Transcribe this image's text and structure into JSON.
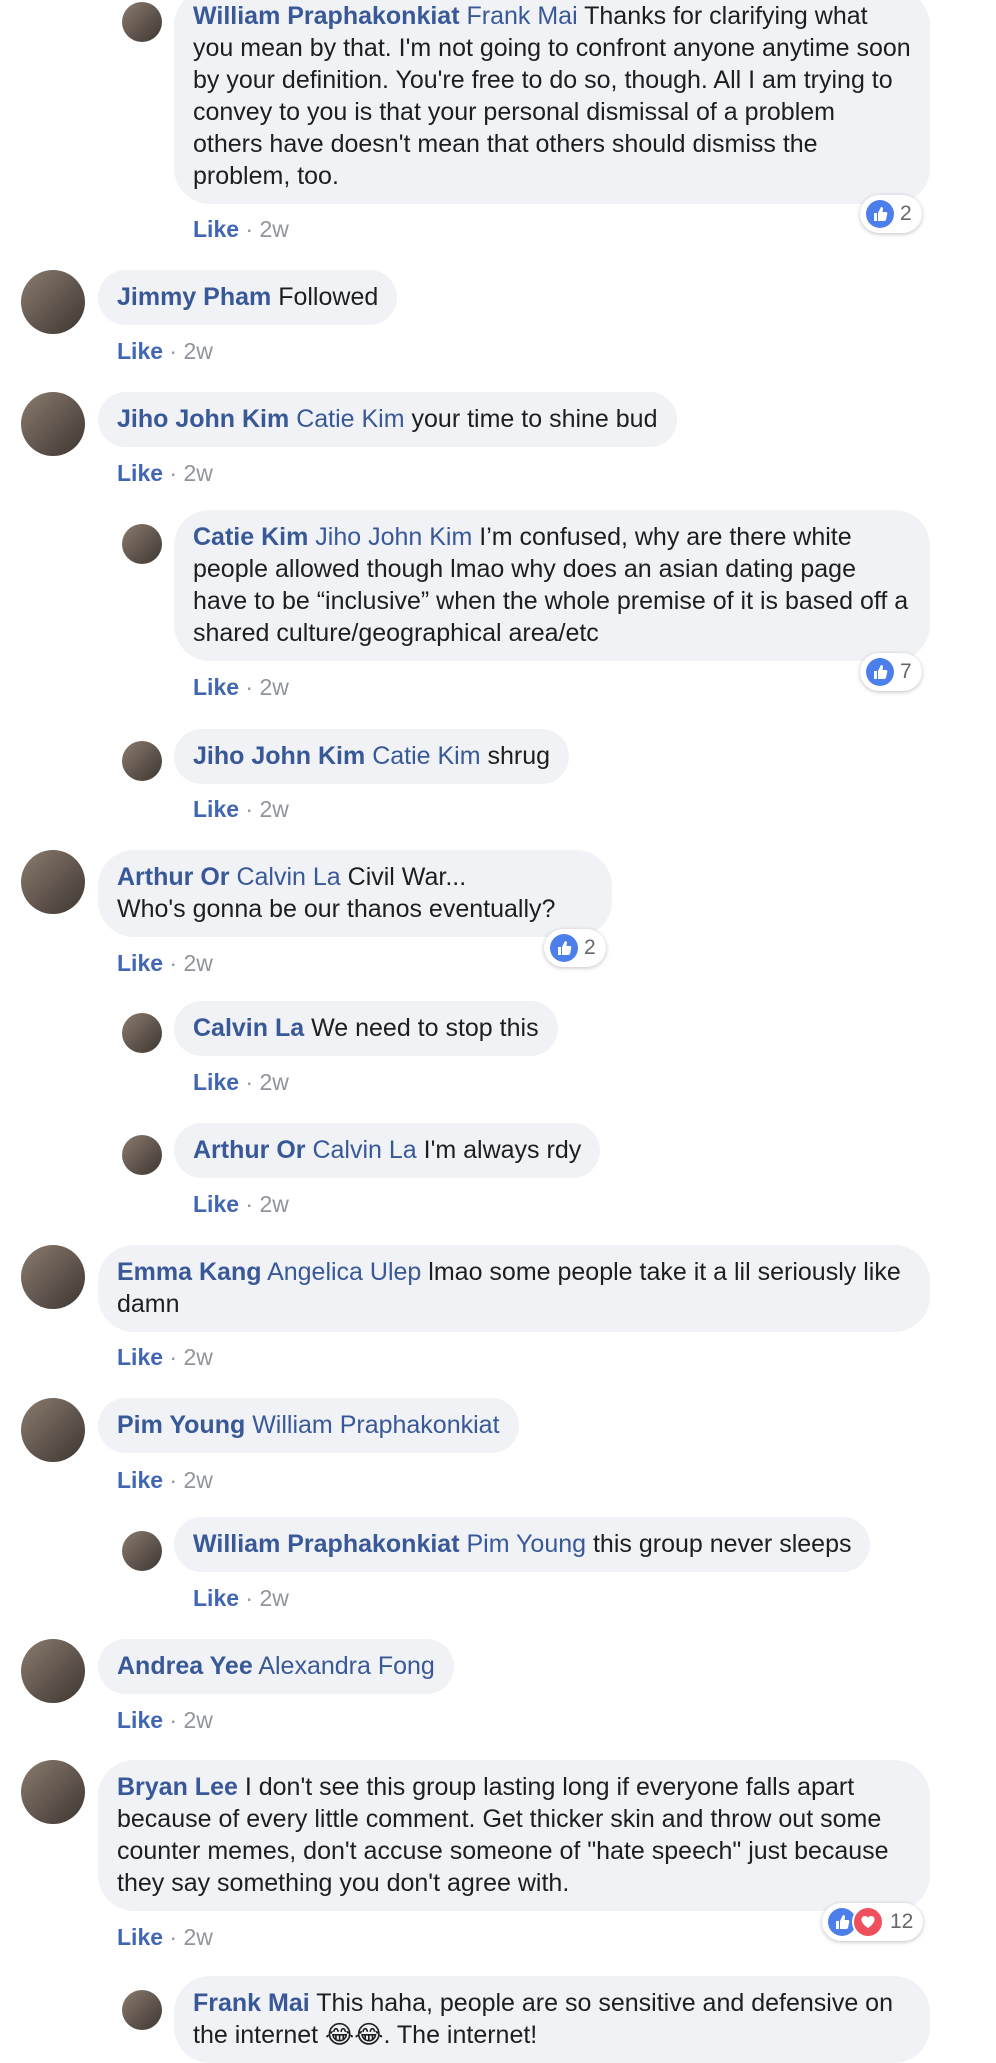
{
  "like_label": "Like",
  "separator": " · ",
  "colors": {
    "name": "#385898",
    "like": "#4267b2",
    "bubble": "#f0f2f5",
    "like_badge": "#4d7fea",
    "love_badge": "#f0505e"
  },
  "comments": [
    {
      "author": "William Praphakonkiat",
      "tag": "Frank Mai",
      "text": "Thanks for clarifying what you mean by that. I'm not going to confront anyone anytime soon by your definition. You're free to do so, though. All I am trying to convey to you is that your personal dismissal of a problem others have doesn't mean that others should dismiss the problem, too.",
      "time": "2w",
      "reaction_count": "2",
      "reaction_icons": [
        "like-icon"
      ]
    },
    {
      "author": "Jimmy Pham",
      "tag": "",
      "text": "Followed",
      "time": "2w"
    },
    {
      "author": "Jiho John Kim",
      "tag": "Catie Kim",
      "text": "your time to shine bud",
      "time": "2w"
    },
    {
      "author": "Catie Kim",
      "tag": "Jiho John Kim",
      "text": "I’m confused, why are there white people allowed though lmao why does an asian dating page have to be “inclusive” when the whole premise of it is based off a shared culture/geographical area/etc",
      "time": "2w",
      "reaction_count": "7",
      "reaction_icons": [
        "like-icon"
      ]
    },
    {
      "author": "Jiho John Kim",
      "tag": "Catie Kim",
      "text": "shrug",
      "time": "2w"
    },
    {
      "author": "Arthur Or",
      "tag": "Calvin La",
      "text": "Civil War...",
      "text2": "Who's gonna be our thanos eventually?",
      "time": "2w",
      "reaction_count": "2",
      "reaction_icons": [
        "like-icon"
      ]
    },
    {
      "author": "Calvin La",
      "tag": "",
      "text": "We need to stop this",
      "time": "2w"
    },
    {
      "author": "Arthur Or",
      "tag": "Calvin La",
      "text": "I'm always rdy",
      "time": "2w"
    },
    {
      "author": "Emma Kang",
      "tag": "Angelica Ulep",
      "text": "lmao some people take it a lil seriously like damn",
      "time": "2w"
    },
    {
      "author": "Pim Young",
      "tag": "William Praphakonkiat",
      "text": "",
      "time": "2w"
    },
    {
      "author": "William Praphakonkiat",
      "tag": "Pim Young",
      "text": "this group never sleeps",
      "time": "2w"
    },
    {
      "author": "Andrea Yee",
      "tag": "Alexandra Fong",
      "text": "",
      "time": "2w"
    },
    {
      "author": "Bryan Lee",
      "tag": "",
      "text": "I don't see this group lasting long if everyone falls apart because of every little comment. Get thicker skin and throw out some counter memes, don't accuse someone of \"hate speech\" just because they say something you don't agree with.",
      "time": "2w",
      "reaction_count": "12",
      "reaction_icons": [
        "like-icon",
        "love-icon"
      ]
    },
    {
      "author": "Frank Mai",
      "tag": "",
      "text": "This haha, people are so sensitive and defensive on the internet 😂😂. The internet!"
    }
  ]
}
